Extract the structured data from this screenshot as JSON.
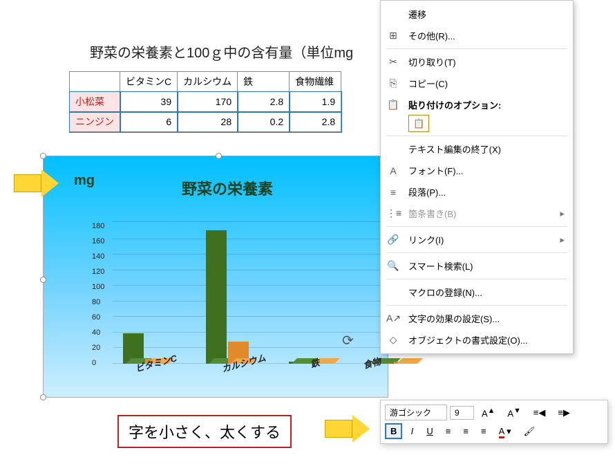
{
  "title": "野菜の栄養素と100ｇ中の含有量（単位mg",
  "table": {
    "headers": [
      "",
      "ビタミンC",
      "カルシウム",
      "鉄",
      "食物繊維"
    ],
    "rows": [
      {
        "name": "小松菜",
        "values": [
          39,
          170,
          2.8,
          1.9
        ]
      },
      {
        "name": "ニンジン",
        "values": [
          6,
          28,
          0.2,
          2.8
        ]
      }
    ]
  },
  "chart": {
    "title": "野菜の栄養素",
    "y_unit": "mg",
    "y_ticks": [
      0,
      20,
      40,
      60,
      80,
      100,
      120,
      140,
      160,
      180
    ],
    "x_labels": [
      "ビタミンC",
      "カルシウム",
      "鉄",
      "食物"
    ]
  },
  "chart_data": {
    "type": "bar",
    "categories": [
      "ビタミンC",
      "カルシウム",
      "鉄",
      "食物繊維"
    ],
    "series": [
      {
        "name": "小松菜",
        "values": [
          39,
          170,
          2.8,
          1.9
        ]
      },
      {
        "name": "ニンジン",
        "values": [
          6,
          28,
          0.2,
          2.8
        ]
      }
    ],
    "title": "野菜の栄養素",
    "xlabel": "",
    "ylabel": "mg",
    "ylim": [
      0,
      180
    ]
  },
  "context_menu": {
    "items": [
      {
        "icon": "",
        "label": "遷移"
      },
      {
        "icon": "⊞",
        "label": "その他(R)..."
      },
      {
        "sep": true
      },
      {
        "icon": "✂",
        "label": "切り取り(T)"
      },
      {
        "icon": "⎘",
        "label": "コピー(C)"
      },
      {
        "icon": "📋",
        "label": "貼り付けのオプション:",
        "bold": true
      },
      {
        "paste_icon": true
      },
      {
        "sep": true
      },
      {
        "icon": "",
        "label": "テキスト編集の終了(X)"
      },
      {
        "icon": "A",
        "label": "フォント(F)..."
      },
      {
        "icon": "≡",
        "label": "段落(P)..."
      },
      {
        "icon": "⋮≡",
        "label": "箇条書き(B)",
        "dis": true,
        "arrow": true
      },
      {
        "sep": true
      },
      {
        "icon": "🔗",
        "label": "リンク(I)",
        "arrow": true
      },
      {
        "sep": true
      },
      {
        "icon": "🔍",
        "label": "スマート検索(L)"
      },
      {
        "sep": true
      },
      {
        "icon": "",
        "label": "マクロの登録(N)..."
      },
      {
        "sep": true
      },
      {
        "icon": "A↗",
        "label": "文字の効果の設定(S)..."
      },
      {
        "icon": "◇",
        "label": "オブジェクトの書式設定(O)..."
      }
    ]
  },
  "format_bar": {
    "font": "游ゴシック",
    "size": "9",
    "inc": "A▲",
    "dec": "A▼",
    "bold": "B",
    "italic": "I",
    "underline": "U",
    "font_color": "A"
  },
  "note": "字を小さく、太くする"
}
